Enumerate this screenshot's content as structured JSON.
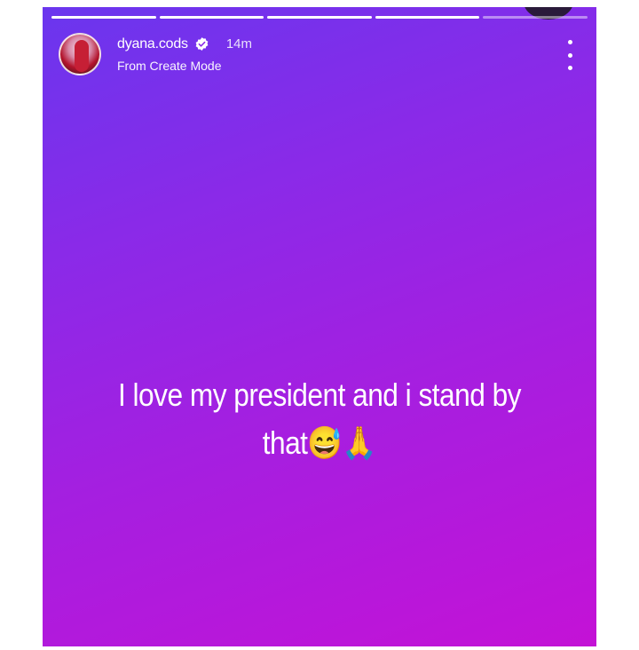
{
  "story": {
    "progress_segments": 5,
    "progress_completed": 4,
    "account": {
      "username": "dyana.cods",
      "verified": true,
      "verified_icon": "verified-badge-icon",
      "posted_ago": "14m",
      "subtitle": "From Create Mode"
    },
    "more_icon": "more-vertical-icon",
    "caption": "I love my president and i stand by that😅🙏",
    "colors": {
      "gradient_start": "#6a36ee",
      "gradient_end": "#c412d6",
      "text": "#ffffff"
    }
  }
}
